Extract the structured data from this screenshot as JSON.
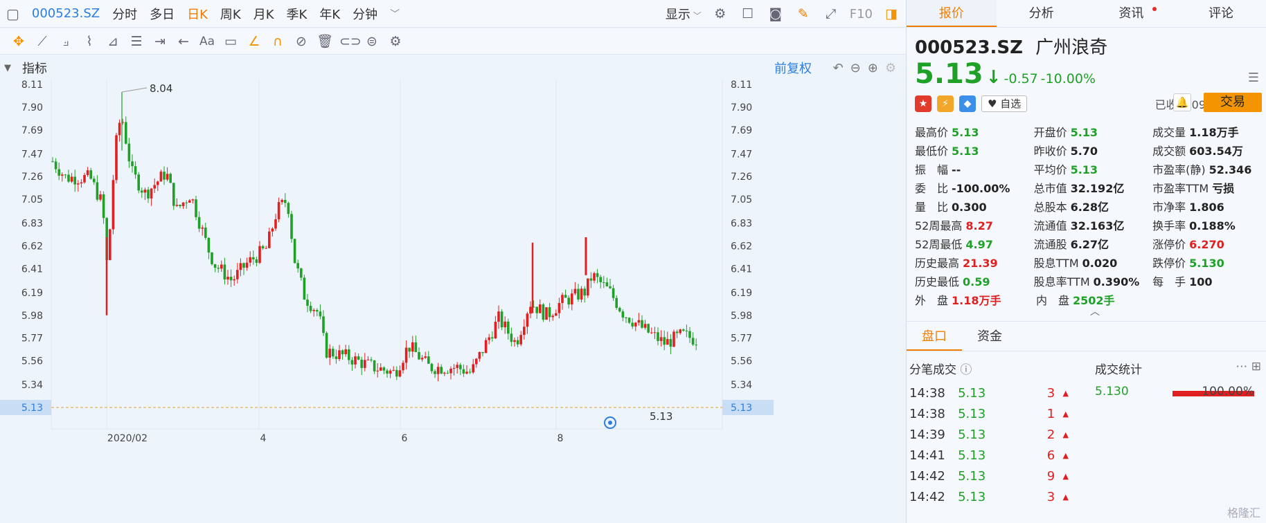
{
  "toolbar": {
    "code": "000523.SZ",
    "periods": [
      "分时",
      "多日",
      "日K",
      "周K",
      "月K",
      "季K",
      "年K",
      "分钟"
    ],
    "active_period": "日K",
    "display_label": "显示",
    "f10_label": "F10"
  },
  "drawing_tools": [
    "move-icon",
    "line-icon",
    "polyline-icon",
    "wave-icon",
    "measure-icon",
    "fib-icon",
    "hline-icon",
    "arrow-icon",
    "text-icon",
    "comment-icon",
    "pencil-icon",
    "magnet-icon",
    "hide-icon",
    "trash-icon",
    "link-icon",
    "sync-icon",
    "settings-icon"
  ],
  "indicator_bar": {
    "label": "指标",
    "adjust": "前复权"
  },
  "chart_data": {
    "type": "candlestick",
    "x_tick_labels": [
      "2020/02",
      "4",
      "6",
      "8"
    ],
    "y_tick_labels": [
      "8.11",
      "7.90",
      "7.69",
      "7.47",
      "7.26",
      "7.05",
      "6.83",
      "6.62",
      "6.41",
      "6.19",
      "5.98",
      "5.77",
      "5.56",
      "5.34",
      "5.13"
    ],
    "ylim": [
      5.13,
      8.11
    ],
    "annotations": {
      "high_label": "8.04",
      "last_price_label": "5.13",
      "last_price_axis_label": "5.13"
    },
    "colors": {
      "up": "#e02020",
      "down": "#1fa027",
      "event_dot": "#2b7ee0",
      "last_line": "#e0a030"
    }
  },
  "tabs": [
    {
      "label": "报价"
    },
    {
      "label": "分析"
    },
    {
      "label": "资讯"
    },
    {
      "label": "评论"
    }
  ],
  "stock": {
    "code": "000523.SZ",
    "name": "广州浪奇",
    "price": "5.13",
    "arrow": "↓",
    "change": "-0.57",
    "change_pct": "-10.00%",
    "status": "已收盘 09/28 15:00",
    "watch_label": "自选",
    "trade_label": "交易"
  },
  "quote_rows": [
    [
      {
        "k": "最高价",
        "v": "5.13",
        "c": "dn"
      },
      {
        "k": "开盘价",
        "v": "5.13",
        "c": "dn"
      },
      {
        "k": "成交量",
        "v": "1.18万手",
        "c": "nt"
      }
    ],
    [
      {
        "k": "最低价",
        "v": "5.13",
        "c": "dn"
      },
      {
        "k": "昨收价",
        "v": "5.70",
        "c": "nt"
      },
      {
        "k": "成交额",
        "v": "603.54万",
        "c": "nt"
      }
    ],
    [
      {
        "k": "振　幅",
        "v": "--",
        "c": "nt"
      },
      {
        "k": "平均价",
        "v": "5.13",
        "c": "dn"
      },
      {
        "k": "市盈率(静)",
        "v": "52.346",
        "c": "nt"
      }
    ],
    [
      {
        "k": "委　比",
        "v": "-100.00%",
        "c": "nt"
      },
      {
        "k": "总市值",
        "v": "32.192亿",
        "c": "nt"
      },
      {
        "k": "市盈率TTM",
        "v": "亏损",
        "c": "nt"
      }
    ],
    [
      {
        "k": "量　比",
        "v": "0.300",
        "c": "nt"
      },
      {
        "k": "总股本",
        "v": "6.28亿",
        "c": "nt"
      },
      {
        "k": "市净率",
        "v": "1.806",
        "c": "nt"
      }
    ],
    [
      {
        "k": "52周最高",
        "v": "8.27",
        "c": "up"
      },
      {
        "k": "流通值",
        "v": "32.163亿",
        "c": "nt"
      },
      {
        "k": "换手率",
        "v": "0.188%",
        "c": "nt"
      }
    ],
    [
      {
        "k": "52周最低",
        "v": "4.97",
        "c": "dn"
      },
      {
        "k": "流通股",
        "v": "6.27亿",
        "c": "nt"
      },
      {
        "k": "涨停价",
        "v": "6.270",
        "c": "up"
      }
    ],
    [
      {
        "k": "历史最高",
        "v": "21.39",
        "c": "up"
      },
      {
        "k": "股息TTM",
        "v": "0.020",
        "c": "nt"
      },
      {
        "k": "跌停价",
        "v": "5.130",
        "c": "dn"
      }
    ],
    [
      {
        "k": "历史最低",
        "v": "0.59",
        "c": "dn"
      },
      {
        "k": "股息率TTM",
        "v": "0.390%",
        "c": "nt"
      },
      {
        "k": "每　手",
        "v": "100",
        "c": "nt"
      }
    ],
    [
      {
        "k": "外　盘",
        "v": "1.18万手",
        "c": "up"
      },
      {
        "k": "内　盘",
        "v": "2502手",
        "c": "dn"
      }
    ]
  ],
  "subtabs": [
    "盘口",
    "资金"
  ],
  "ticks_title": "分笔成交",
  "ticks": [
    {
      "t": "14:38",
      "p": "5.13",
      "v": "3"
    },
    {
      "t": "14:38",
      "p": "5.13",
      "v": "1"
    },
    {
      "t": "14:39",
      "p": "5.13",
      "v": "2"
    },
    {
      "t": "14:41",
      "p": "5.13",
      "v": "6"
    },
    {
      "t": "14:42",
      "p": "5.13",
      "v": "9"
    },
    {
      "t": "14:42",
      "p": "5.13",
      "v": "3"
    }
  ],
  "stats": {
    "title": "成交统计",
    "price": "5.130",
    "pct": "100.00%"
  },
  "watermark": "格隆汇"
}
